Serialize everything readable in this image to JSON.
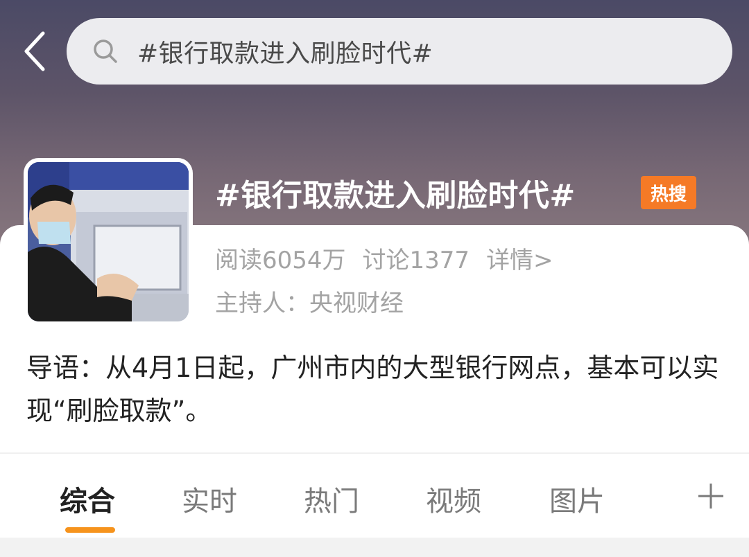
{
  "search": {
    "query": "#银行取款进入刷脸时代#"
  },
  "topic": {
    "title": "#银行取款进入刷脸时代#",
    "badge": "热搜",
    "reads": "阅读6054万",
    "discussions": "讨论1377",
    "details": "详情>",
    "host": "主持人：央视财经",
    "lead": "导语：从4月1日起，广州市内的大型银行网点，基本可以实现“刷脸取款”。"
  },
  "tabs": [
    {
      "label": "综合",
      "active": true
    },
    {
      "label": "实时",
      "active": false
    },
    {
      "label": "热门",
      "active": false
    },
    {
      "label": "视频",
      "active": false
    },
    {
      "label": "图片",
      "active": false
    }
  ],
  "colors": {
    "accent": "#f6931c",
    "badge": "#f57a26"
  },
  "icons": {
    "back": "back-chevron-icon",
    "search": "search-icon",
    "more": "plus-icon"
  }
}
